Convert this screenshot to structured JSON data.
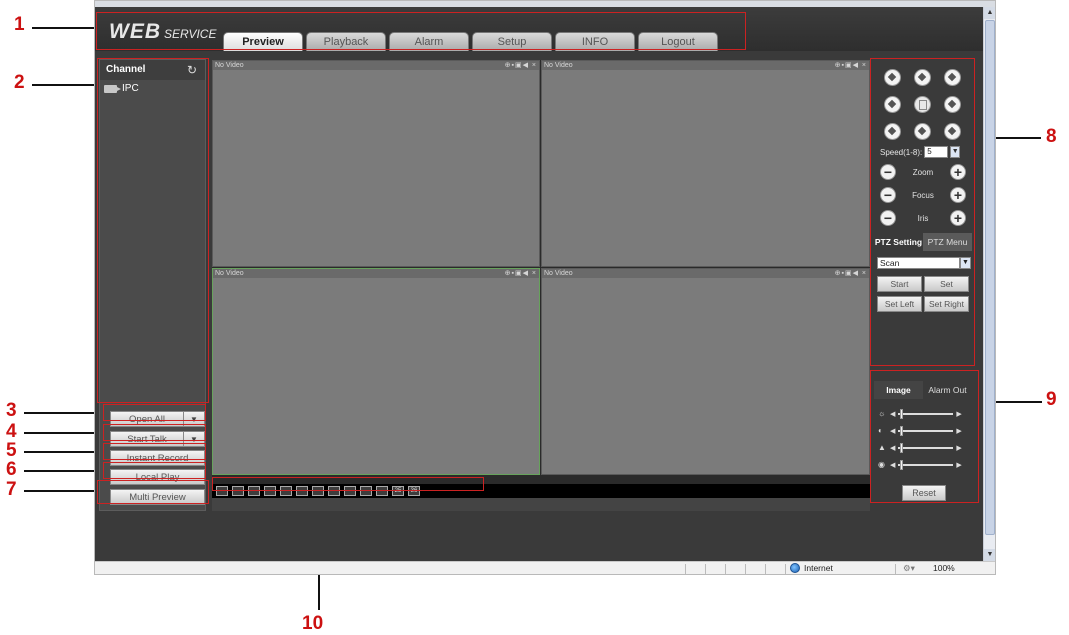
{
  "annotations": [
    "1",
    "2",
    "3",
    "4",
    "5",
    "6",
    "7",
    "8",
    "9",
    "10"
  ],
  "logo": {
    "web": "WEB",
    "service": "SERVICE"
  },
  "tabs": [
    "Preview",
    "Playback",
    "Alarm",
    "Setup",
    "INFO",
    "Logout"
  ],
  "active_tab": "Preview",
  "channel_panel": {
    "title": "Channel",
    "refresh_icon": "refresh-icon",
    "items": [
      {
        "label": "IPC",
        "icon": "camera-icon"
      }
    ]
  },
  "left_buttons": {
    "open_all": "Open All",
    "start_talk": "Start Talk",
    "instant_record": "Instant Record",
    "local_play": "Local Play",
    "multi_preview": "Multi Preview"
  },
  "video_cells": [
    {
      "label": "No Video",
      "icons": "⊕▪▣◀ ×"
    },
    {
      "label": "No Video",
      "icons": "⊕▪▣◀ ×"
    },
    {
      "label": "No Video",
      "icons": "⊕▪▣◀ ×"
    },
    {
      "label": "No Video",
      "icons": "⊕▪▣◀ ×"
    }
  ],
  "layout_buttons": [
    "",
    "",
    "",
    "",
    "",
    "",
    "",
    "",
    "",
    "",
    "",
    "",
    "25",
    "36"
  ],
  "ptz": {
    "speed_label": "Speed(1-8):",
    "speed_value": "5",
    "zoom": "Zoom",
    "focus": "Focus",
    "iris": "Iris",
    "tab_setting": "PTZ Setting",
    "tab_menu": "PTZ Menu",
    "mode": "Scan",
    "start": "Start",
    "set": "Set",
    "set_left": "Set Left",
    "set_right": "Set Right"
  },
  "image_panel": {
    "tab_image": "Image",
    "tab_alarm_out": "Alarm Out",
    "reset": "Reset",
    "sliders": [
      "brightness",
      "contrast",
      "saturation",
      "hue"
    ]
  },
  "statusbar": {
    "zone": "Internet",
    "zoom": "100%",
    "protected_icon": "⚙▾"
  },
  "colors": {
    "annotation": "#cc1111",
    "selected_border": "#67a35c",
    "panel_bg": "#3a3a3a"
  }
}
